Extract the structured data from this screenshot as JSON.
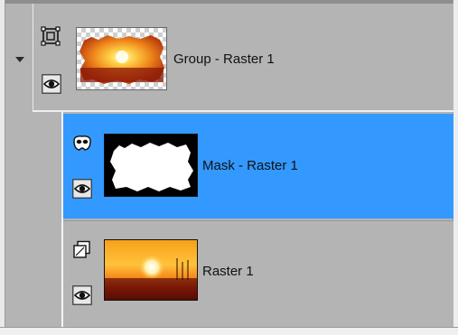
{
  "layers_panel": {
    "layers": [
      {
        "name": "Group - Raster 1",
        "type_icon": "group-layer-icon",
        "visibility_icon": "eye-icon",
        "expanded": true
      },
      {
        "name": "Mask - Raster 1",
        "type_icon": "mask-layer-icon",
        "visibility_icon": "eye-icon",
        "selected": true
      },
      {
        "name": "Raster 1",
        "type_icon": "raster-layer-icon",
        "visibility_icon": "eye-icon"
      }
    ],
    "colors": {
      "panel_bg": "#b4b4b4",
      "selected_row": "#3399ff"
    }
  }
}
